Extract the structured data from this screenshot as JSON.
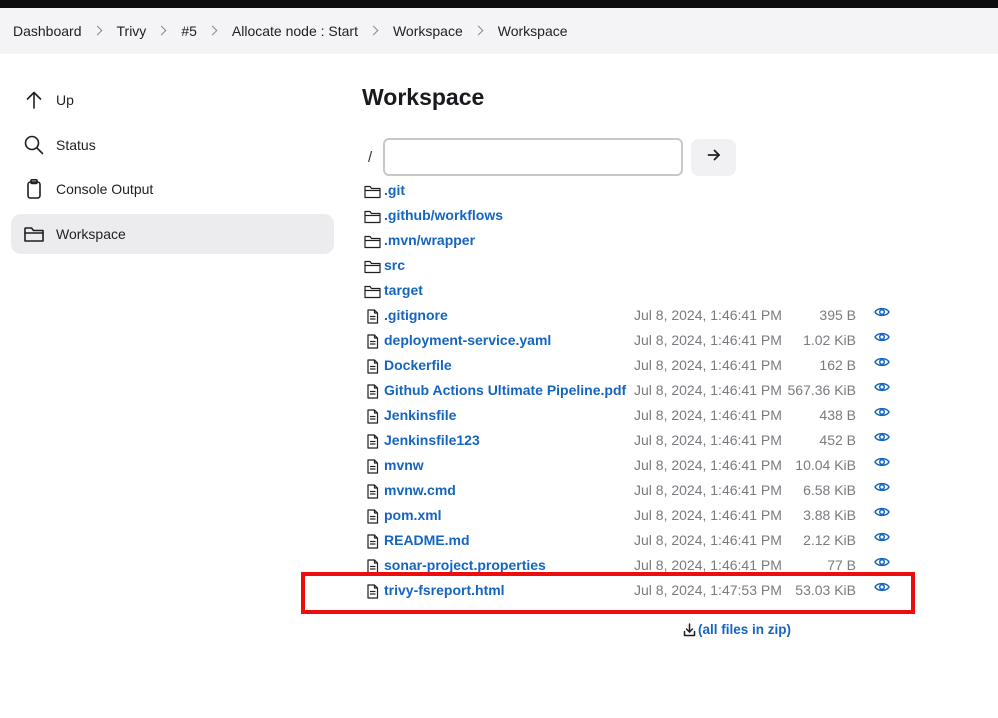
{
  "breadcrumb": [
    "Dashboard",
    "Trivy",
    "#5",
    "Allocate node : Start",
    "Workspace",
    "Workspace"
  ],
  "sidebar": {
    "items": [
      {
        "label": "Up",
        "icon": "arrow-up-icon",
        "active": false
      },
      {
        "label": "Status",
        "icon": "search-icon",
        "active": false
      },
      {
        "label": "Console Output",
        "icon": "clipboard-icon",
        "active": false
      },
      {
        "label": "Workspace",
        "icon": "folder-icon",
        "active": true
      }
    ]
  },
  "main": {
    "title": "Workspace",
    "path_prefix": "/",
    "path_value": "",
    "go_icon": "arrow-right-icon",
    "files": [
      {
        "type": "folder",
        "name": ".git",
        "date": "",
        "size": ""
      },
      {
        "type": "folder",
        "name": ".github/workflows",
        "date": "",
        "size": ""
      },
      {
        "type": "folder",
        "name": ".mvn/wrapper",
        "date": "",
        "size": ""
      },
      {
        "type": "folder",
        "name": "src",
        "date": "",
        "size": ""
      },
      {
        "type": "folder",
        "name": "target",
        "date": "",
        "size": ""
      },
      {
        "type": "file",
        "name": ".gitignore",
        "date": "Jul 8, 2024, 1:46:41 PM",
        "size": "395 B"
      },
      {
        "type": "file",
        "name": "deployment-service.yaml",
        "date": "Jul 8, 2024, 1:46:41 PM",
        "size": "1.02 KiB"
      },
      {
        "type": "file",
        "name": "Dockerfile",
        "date": "Jul 8, 2024, 1:46:41 PM",
        "size": "162 B"
      },
      {
        "type": "file",
        "name": "Github Actions Ultimate Pipeline.pdf",
        "date": "Jul 8, 2024, 1:46:41 PM",
        "size": "567.36 KiB"
      },
      {
        "type": "file",
        "name": "Jenkinsfile",
        "date": "Jul 8, 2024, 1:46:41 PM",
        "size": "438 B"
      },
      {
        "type": "file",
        "name": "Jenkinsfile123",
        "date": "Jul 8, 2024, 1:46:41 PM",
        "size": "452 B"
      },
      {
        "type": "file",
        "name": "mvnw",
        "date": "Jul 8, 2024, 1:46:41 PM",
        "size": "10.04 KiB"
      },
      {
        "type": "file",
        "name": "mvnw.cmd",
        "date": "Jul 8, 2024, 1:46:41 PM",
        "size": "6.58 KiB"
      },
      {
        "type": "file",
        "name": "pom.xml",
        "date": "Jul 8, 2024, 1:46:41 PM",
        "size": "3.88 KiB"
      },
      {
        "type": "file",
        "name": "README.md",
        "date": "Jul 8, 2024, 1:46:41 PM",
        "size": "2.12 KiB"
      },
      {
        "type": "file",
        "name": "sonar-project.properties",
        "date": "Jul 8, 2024, 1:46:41 PM",
        "size": "77 B"
      },
      {
        "type": "file",
        "name": "trivy-fsreport.html",
        "date": "Jul 8, 2024, 1:47:53 PM",
        "size": "53.03 KiB"
      }
    ],
    "zip_label": "(all files in zip)",
    "zip_icon": "download-icon",
    "highlighted_file": "trivy-fsreport.html",
    "highlight_color": "#ee0d0d",
    "link_color": "#1565c0"
  }
}
